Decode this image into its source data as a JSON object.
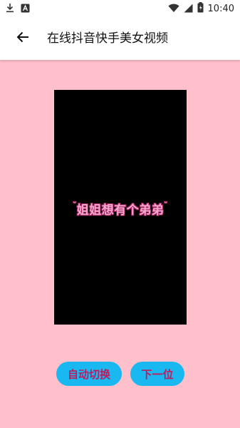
{
  "status_bar": {
    "time": "10:40",
    "left_icons": [
      "download-icon",
      "a-icon"
    ],
    "right_icons": [
      "wifi-icon",
      "signal-icon",
      "battery-icon"
    ]
  },
  "app_bar": {
    "back_icon": "arrow-left-icon",
    "title": "在线抖音快手美女视频"
  },
  "video": {
    "caption_deco_left": "ᵕ",
    "caption": "姐姐想有个弟弟",
    "caption_deco_right": "ᵕ"
  },
  "buttons": {
    "auto_switch": "自动切换",
    "next": "下一位"
  },
  "colors": {
    "background": "#ffc0cb",
    "button_bg": "#1ab8f0",
    "button_text": "#c2195c",
    "video_bg": "#000000"
  }
}
